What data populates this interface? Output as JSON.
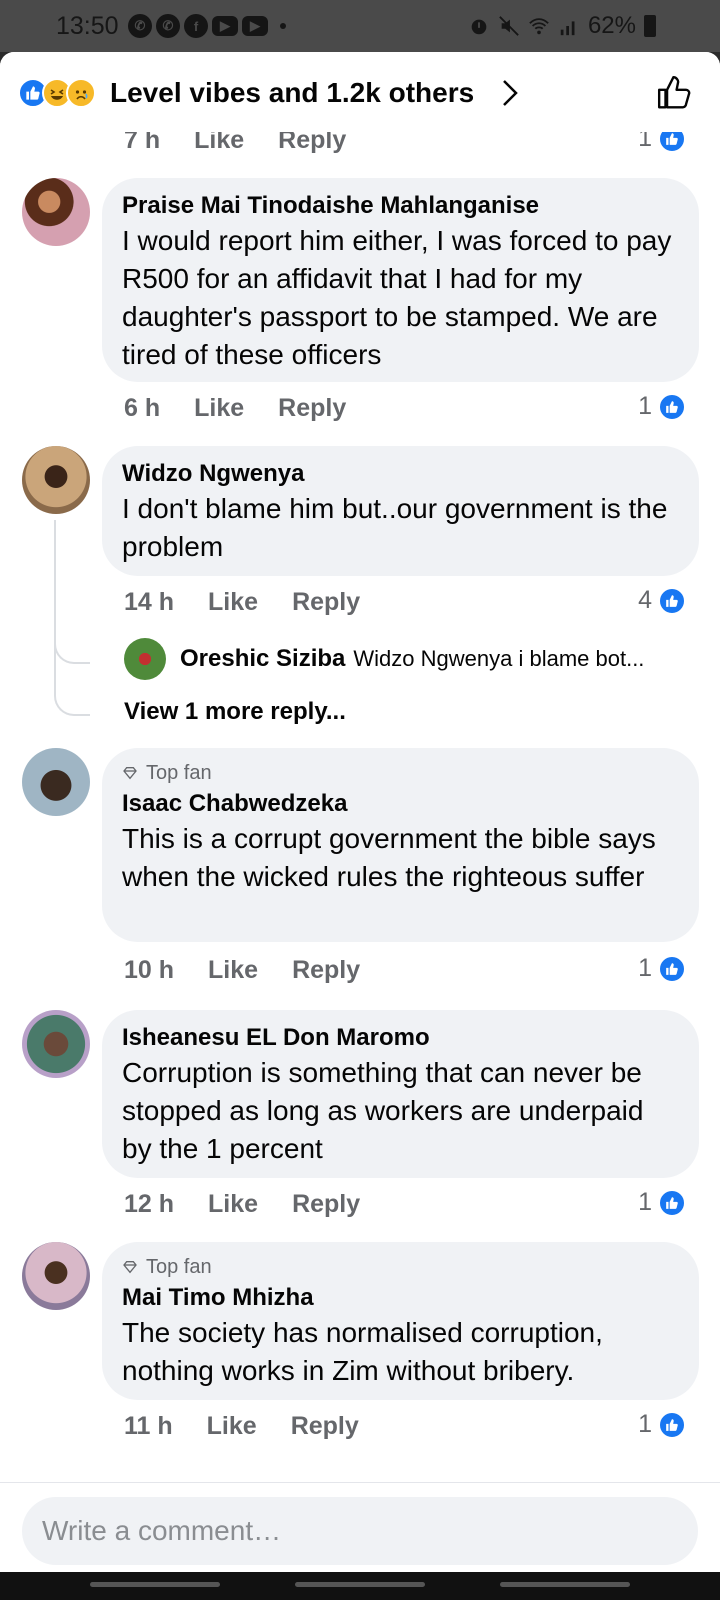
{
  "status_bar": {
    "time": "13:50",
    "battery": "62%",
    "left_icons": [
      "whatsapp-icon",
      "whatsapp-icon",
      "facebook-icon",
      "youtube-icon",
      "youtube-icon"
    ],
    "right_icons": [
      "alarm-icon",
      "mute-icon",
      "wifi-icon",
      "signal-icon",
      "battery-icon"
    ]
  },
  "header": {
    "reactions": [
      "like",
      "haha",
      "sad"
    ],
    "summary": "Level vibes and 1.2k others"
  },
  "partial_top": {
    "time": "7 h",
    "like": "Like",
    "reply": "Reply",
    "count": "1"
  },
  "comments": [
    {
      "name": "Praise Mai Tinodaishe Mahlanganise",
      "text": "I would report him either, I was forced to pay R500 for an affidavit that I had for my daughter's passport to be stamped. We are tired of these officers",
      "time": "6 h",
      "like": "Like",
      "reply": "Reply",
      "count": "1"
    },
    {
      "name": "Widzo Ngwenya",
      "text": "I don't blame him but..our government is the problem",
      "time": "14 h",
      "like": "Like",
      "reply": "Reply",
      "count": "4",
      "reply_preview": {
        "name": "Oreshic Siziba",
        "text": "Widzo Ngwenya i blame bot..."
      },
      "view_more": "View 1 more reply..."
    },
    {
      "badge": "Top fan",
      "name": "Isaac Chabwedzeka",
      "text": "This is a corrupt government the bible says when the wicked rules the righteous suffer",
      "time": "10 h",
      "like": "Like",
      "reply": "Reply",
      "count": "1"
    },
    {
      "name": "Isheanesu EL Don Maromo",
      "text": "Corruption is something that can never be stopped as long as workers are underpaid by the 1 percent",
      "time": "12 h",
      "like": "Like",
      "reply": "Reply",
      "count": "1"
    },
    {
      "badge": "Top fan",
      "name": "Mai Timo Mhizha",
      "text": "The society has normalised corruption, nothing works in Zim without bribery.",
      "time": "11 h",
      "like": "Like",
      "reply": "Reply",
      "count": "1"
    }
  ],
  "composer": {
    "placeholder": "Write a comment…"
  },
  "colors": {
    "accent": "#1877f2",
    "bubble": "#f0f2f5",
    "secondary_text": "#65676b"
  }
}
